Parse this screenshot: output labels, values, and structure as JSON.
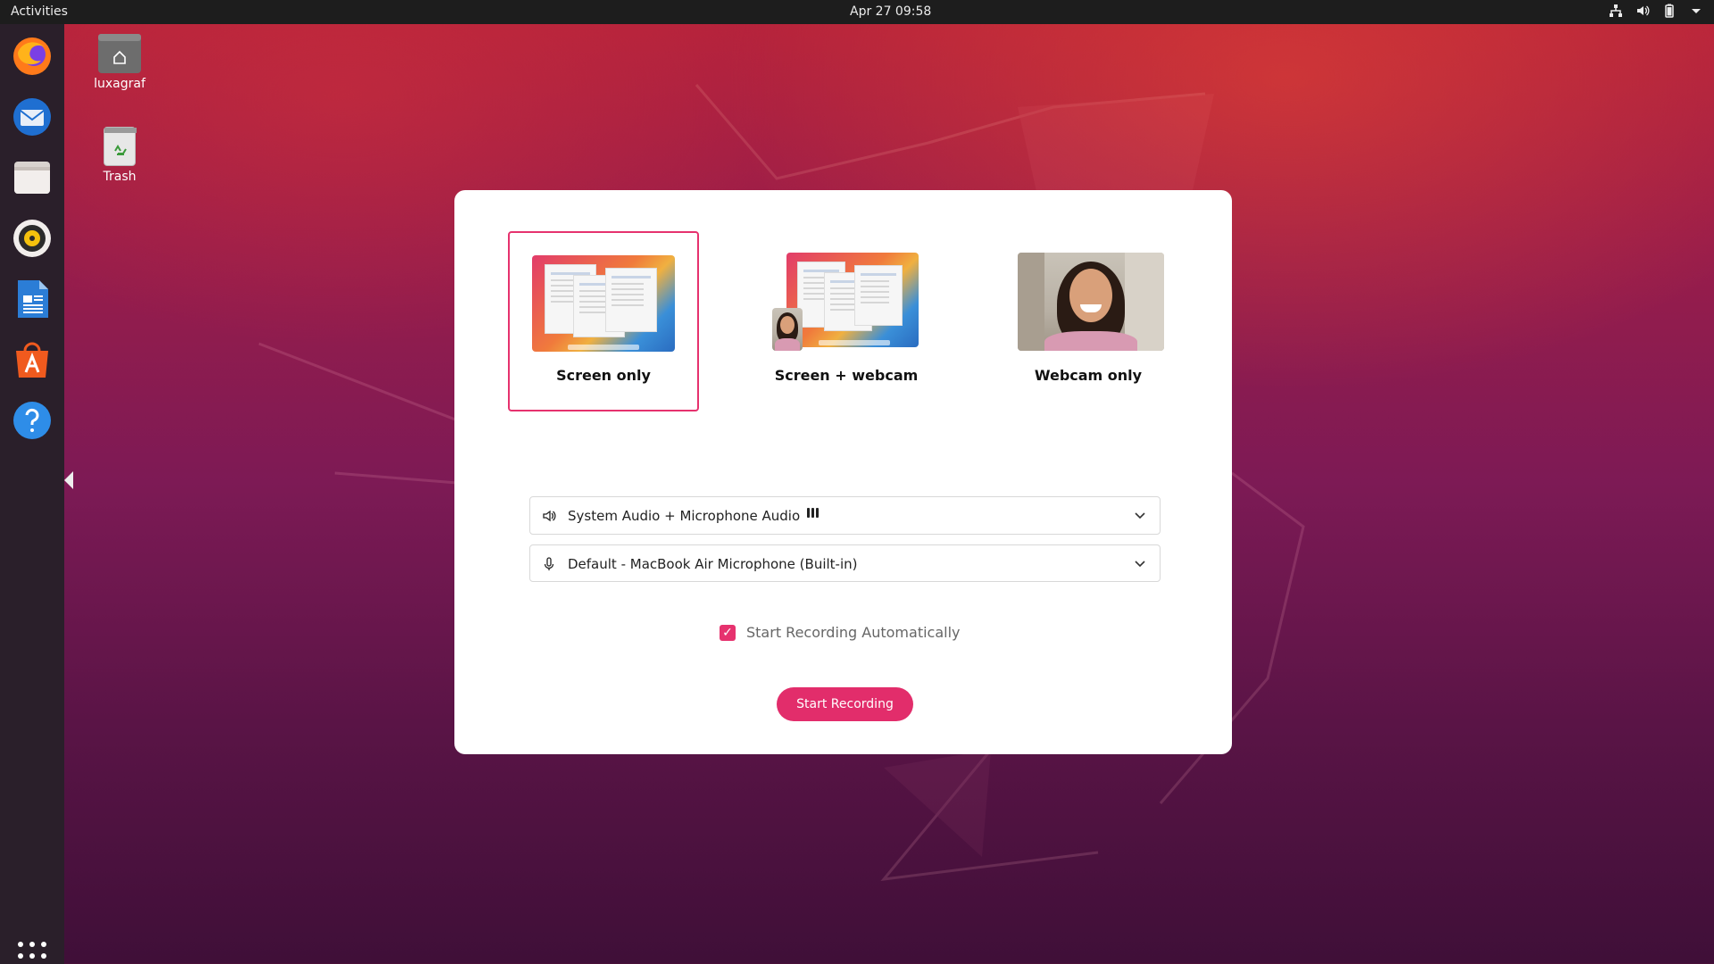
{
  "topbar": {
    "activities": "Activities",
    "clock": "Apr 27  09:58",
    "tray_icons": [
      "network-icon",
      "volume-icon",
      "battery-icon",
      "system-menu-icon"
    ]
  },
  "dock": {
    "items": [
      "Firefox",
      "Thunderbird",
      "Files",
      "Rhythmbox",
      "LibreOffice Writer",
      "Ubuntu Software",
      "Help"
    ]
  },
  "desktop": {
    "icons": [
      {
        "label": "luxagraf",
        "icon": "home-folder-icon"
      },
      {
        "label": "Trash",
        "icon": "trash-icon"
      }
    ]
  },
  "dialog": {
    "options": [
      {
        "label": "Screen only",
        "selected": true
      },
      {
        "label": "Screen + webcam",
        "selected": false
      },
      {
        "label": "Webcam only",
        "selected": false
      }
    ],
    "audio_select": {
      "value": "System Audio + Microphone Audio",
      "icon": "speaker-icon"
    },
    "mic_select": {
      "value": "Default - MacBook Air Microphone (Built-in)",
      "icon": "microphone-icon"
    },
    "auto_start": {
      "label": "Start Recording Automatically",
      "checked": true
    },
    "start_button": "Start Recording"
  },
  "colors": {
    "accent": "#e22d6b",
    "topbar": "#1d1d1d",
    "dialog_bg": "#ffffff"
  }
}
